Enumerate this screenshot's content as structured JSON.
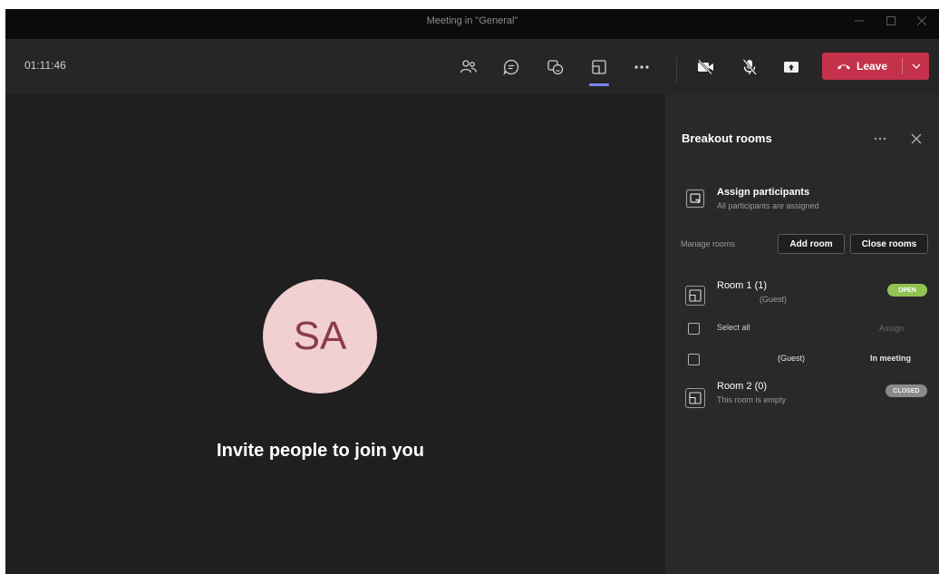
{
  "window": {
    "title": "Meeting in \"General\"",
    "controls": [
      "minimize",
      "maximize",
      "close"
    ]
  },
  "toolbar": {
    "timer": "01:11:46",
    "buttons": [
      {
        "name": "participants-icon"
      },
      {
        "name": "chat-icon"
      },
      {
        "name": "reactions-icon"
      },
      {
        "name": "breakout-rooms-icon",
        "active": true
      },
      {
        "name": "more-options-icon"
      },
      {
        "name": "camera-off-icon"
      },
      {
        "name": "mic-off-icon"
      },
      {
        "name": "share-screen-icon"
      }
    ],
    "leave_label": "Leave"
  },
  "stage": {
    "avatar_initials": "SA",
    "invite_text": "Invite people to join you"
  },
  "panel": {
    "title": "Breakout rooms",
    "assign": {
      "title": "Assign participants",
      "subtitle": "All participants are assigned"
    },
    "manage_label": "Manage rooms",
    "add_room_label": "Add room",
    "close_rooms_label": "Close rooms",
    "rooms": [
      {
        "name": "Room 1 (1)",
        "subtitle": "(Guest)",
        "status": "OPEN"
      },
      {
        "name": "Room 2 (0)",
        "subtitle": "This room is empty",
        "status": "CLOSED"
      }
    ],
    "select_all_label": "Select all",
    "assign_label": "Assign",
    "participant": {
      "name": "(Guest)",
      "status": "In meeting"
    }
  },
  "colors": {
    "accent": "#7f85f5",
    "leave": "#c4314b",
    "open_badge": "#92c353",
    "closed_badge": "#8a8a8a",
    "avatar_bg": "#f1d0d2",
    "avatar_text": "#8a3d46"
  }
}
